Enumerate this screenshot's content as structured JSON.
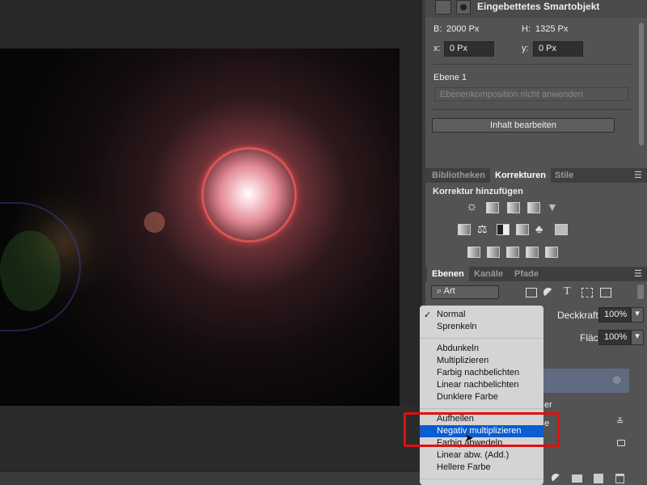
{
  "properties": {
    "title": "Eingebettetes Smartobjekt",
    "width_label": "B:",
    "width_value": "2000 Px",
    "height_label": "H:",
    "height_value": "1325 Px",
    "x_label": "x:",
    "x_value": "0 Px",
    "y_label": "y:",
    "y_value": "0 Px",
    "layer_name": "Ebene 1",
    "comp_select": "Ebenenkomposition nicht anwenden",
    "edit_button": "Inhalt bearbeiten"
  },
  "adjust_tabs": [
    "Bibliotheken",
    "Korrekturen",
    "Stile"
  ],
  "adjust_title": "Korrektur hinzufügen",
  "layer_tabs": [
    "Ebenen",
    "Kanäle",
    "Pfade"
  ],
  "filter": "Art",
  "opacity_label": "Deckkraft:",
  "opacity_value": "100%",
  "fill_label": "Fläche:",
  "fill_value": "100%",
  "layer_fragments": [
    "er",
    "e"
  ],
  "blend_menu": {
    "checked": "Normal",
    "groups": [
      [
        "Normal",
        "Sprenkeln"
      ],
      [
        "Abdunkeln",
        "Multiplizieren",
        "Farbig nachbelichten",
        "Linear nachbelichten",
        "Dunklere Farbe"
      ],
      [
        "Aufhellen",
        "Negativ multiplizieren",
        "Farbig abwedeln",
        "Linear abw. (Add.)",
        "Hellere Farbe"
      ]
    ],
    "selected": "Negativ multiplizieren"
  },
  "highlight_color": "#e01010"
}
